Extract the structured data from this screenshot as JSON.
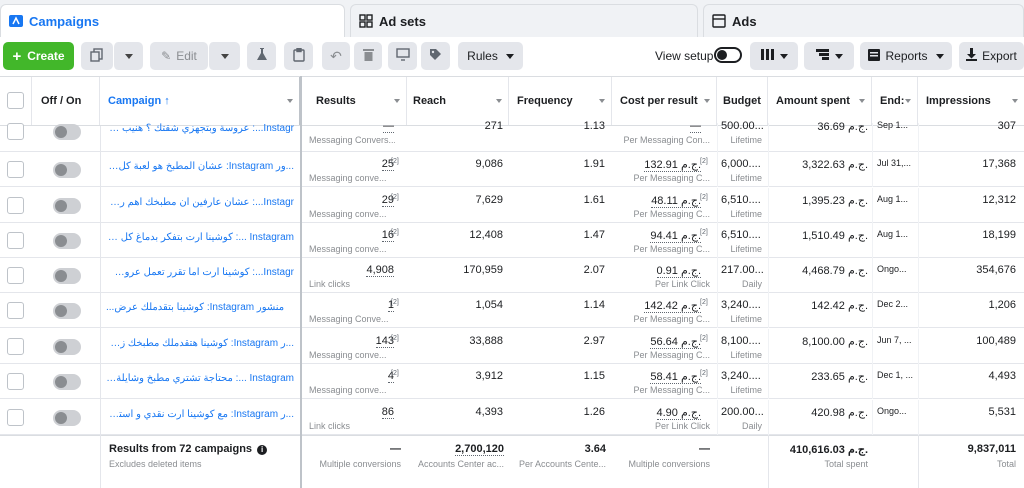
{
  "tabs": [
    {
      "label": "Campaigns",
      "icon": "folder-icon"
    },
    {
      "label": "Ad sets",
      "icon": "grid-icon"
    },
    {
      "label": "Ads",
      "icon": "ad-icon"
    }
  ],
  "toolbar": {
    "create_label": "Create",
    "edit_label": "Edit",
    "rules_label": "Rules",
    "view_setup_label": "View setup",
    "reports_label": "Reports",
    "export_label": "Export"
  },
  "columns": {
    "off_on": "Off / On",
    "campaign": "Campaign ↑",
    "results": "Results",
    "reach": "Reach",
    "frequency": "Frequency",
    "cost_per_result": "Cost per result",
    "budget": "Budget",
    "amount_spent": "Amount spent",
    "ends": "End:",
    "impressions": "Impressions"
  },
  "rows": [
    {
      "campaign": "Instagr...: عروسة وبتجهزي شقتك ؟ هنيب زهقتي...",
      "results": "—",
      "results_sub": "Messaging Convers...",
      "reach": "271",
      "frequency": "1.13",
      "cpr": "—",
      "cpr_sub": "Per Messaging Con...",
      "budget": "500.00...",
      "budget_sub": "Lifetime",
      "spent": "36.69 ج.م.",
      "ends": "Sep 1...",
      "impressions": "307"
    },
    {
      "campaign": "...ور Instagram: عشان المطبخ هو لعبة كل ست...",
      "results": "25",
      "results_sub": "Messaging conve...",
      "reach": "9,086",
      "frequency": "1.91",
      "cpr": "132.91 ج.م.",
      "cpr_sub": "Per Messaging C...",
      "budget": "6,000....",
      "budget_sub": "Lifetime",
      "spent": "3,322.63 ج.م.",
      "ends": "Jul 31,...",
      "impressions": "17,368"
    },
    {
      "campaign": "Instagr...: عشان عارفين ان مطبخك اهم ركن في...",
      "results": "29",
      "results_sub": "Messaging conve...",
      "reach": "7,629",
      "frequency": "1.61",
      "cpr": "48.11 ج.م.",
      "cpr_sub": "Per Messaging C...",
      "budget": "6,510....",
      "budget_sub": "Lifetime",
      "spent": "1,395.23 ج.م.",
      "ends": "Aug 1...",
      "impressions": "12,312"
    },
    {
      "campaign": "Instagram ...: كوشينا أرت بتفكر بدماغ كل ست...",
      "results": "16",
      "results_sub": "Messaging conve...",
      "reach": "12,408",
      "frequency": "1.47",
      "cpr": "94.41 ج.م.",
      "cpr_sub": "Per Messaging C...",
      "budget": "6,510....",
      "budget_sub": "Lifetime",
      "spent": "1,510.49 ج.م.",
      "ends": "Aug 1...",
      "impressions": "18,199"
    },
    {
      "campaign": "Instagr...: كوشينا ارت اما تقرر تعمل عروض...",
      "results": "4,908",
      "results_sub": "Link clicks",
      "reach": "170,959",
      "frequency": "2.07",
      "cpr": "0.91 ج.م.",
      "cpr_sub": "Per Link Click",
      "budget": "217.00...",
      "budget_sub": "Daily",
      "spent": "4,468.79 ج.م.",
      "ends": "Ongo...",
      "impressions": "354,676"
    },
    {
      "campaign": "منشور Instagram: كوشينا بتقدملك عرض...",
      "results": "1",
      "results_sub": "Messaging Conve...",
      "reach": "1,054",
      "frequency": "1.14",
      "cpr": "142.42 ج.م.",
      "cpr_sub": "Per Messaging C...",
      "budget": "3,240....",
      "budget_sub": "Lifetime",
      "spent": "142.42 ج.م.",
      "ends": "Dec 2...",
      "impressions": "1,206"
    },
    {
      "campaign": "...ر Instagram: كوشينا هتقدملك مطبخك زي ما...",
      "results": "143",
      "results_sub": "Messaging conve...",
      "reach": "33,888",
      "frequency": "2.97",
      "cpr": "56.64 ج.م.",
      "cpr_sub": "Per Messaging C...",
      "budget": "8,100....",
      "budget_sub": "Lifetime",
      "spent": "8,100.00 ج.م.",
      "ends": "Jun 7, ...",
      "impressions": "100,489"
    },
    {
      "campaign": "Instagram ...: محتاجة تشتري مطبخ وشايلة هم...",
      "results": "4",
      "results_sub": "Messaging conve...",
      "reach": "3,912",
      "frequency": "1.15",
      "cpr": "58.41 ج.م.",
      "cpr_sub": "Per Messaging C...",
      "budget": "3,240....",
      "budget_sub": "Lifetime",
      "spent": "233.65 ج.م.",
      "ends": "Dec 1, ...",
      "impressions": "4,493"
    },
    {
      "campaign": "...ر Instagram: مع كوشينا أرت نقدي و أستلمي...",
      "results": "86",
      "results_sub": "Link clicks",
      "reach": "4,393",
      "frequency": "1.26",
      "cpr": "4.90 ج.م.",
      "cpr_sub": "Per Link Click",
      "budget": "200.00...",
      "budget_sub": "Daily",
      "spent": "420.98 ج.م.",
      "ends": "Ongo...",
      "impressions": "5,531"
    }
  ],
  "footer": {
    "title": "Results from 72 campaigns",
    "subtitle": "Excludes deleted items",
    "results": "—",
    "results_sub": "Multiple conversions",
    "reach": "2,700,120",
    "reach_sub": "Accounts Center ac...",
    "frequency": "3.64",
    "frequency_sub": "Per Accounts Cente...",
    "cpr": "—",
    "cpr_sub": "Multiple conversions",
    "spent": "410,616.03 ج.م.",
    "spent_sub": "Total spent",
    "impressions": "9,837,011",
    "impressions_sub": "Total"
  },
  "colors": {
    "accent": "#1877f2",
    "create": "#42b72a"
  }
}
